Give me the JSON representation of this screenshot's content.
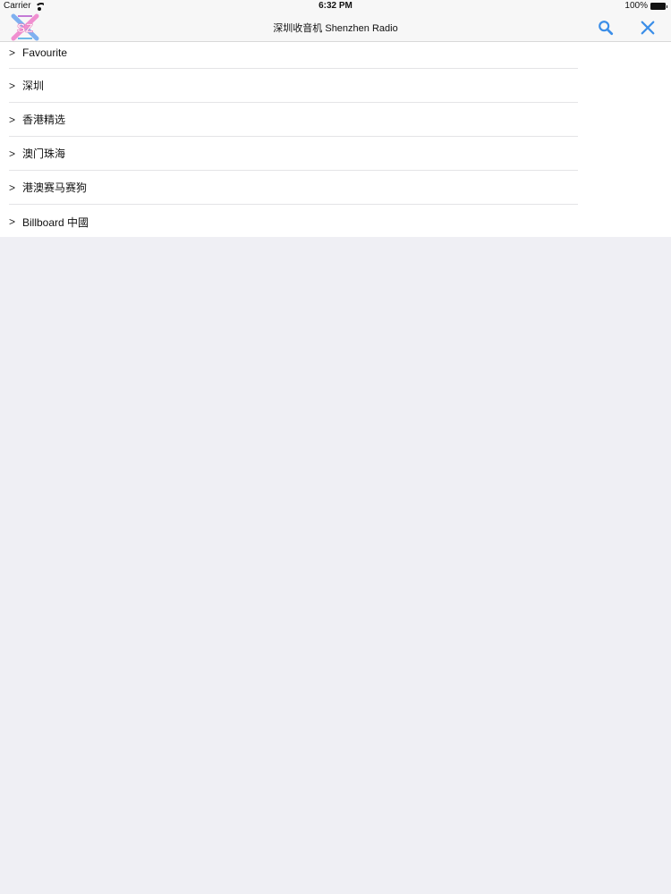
{
  "status_bar": {
    "carrier": "Carrier",
    "time": "6:32 PM",
    "battery": "100%"
  },
  "nav_bar": {
    "logo_text": "SZ",
    "title": "深圳收音机 Shenzhen Radio",
    "accent_color": "#3b8ee8"
  },
  "list": {
    "chevron": ">",
    "items": [
      {
        "label": "Favourite"
      },
      {
        "label": "深圳"
      },
      {
        "label": "香港精选"
      },
      {
        "label": "澳门珠海"
      },
      {
        "label": "港澳赛马赛狗"
      },
      {
        "label": "Billboard 中國"
      }
    ]
  }
}
